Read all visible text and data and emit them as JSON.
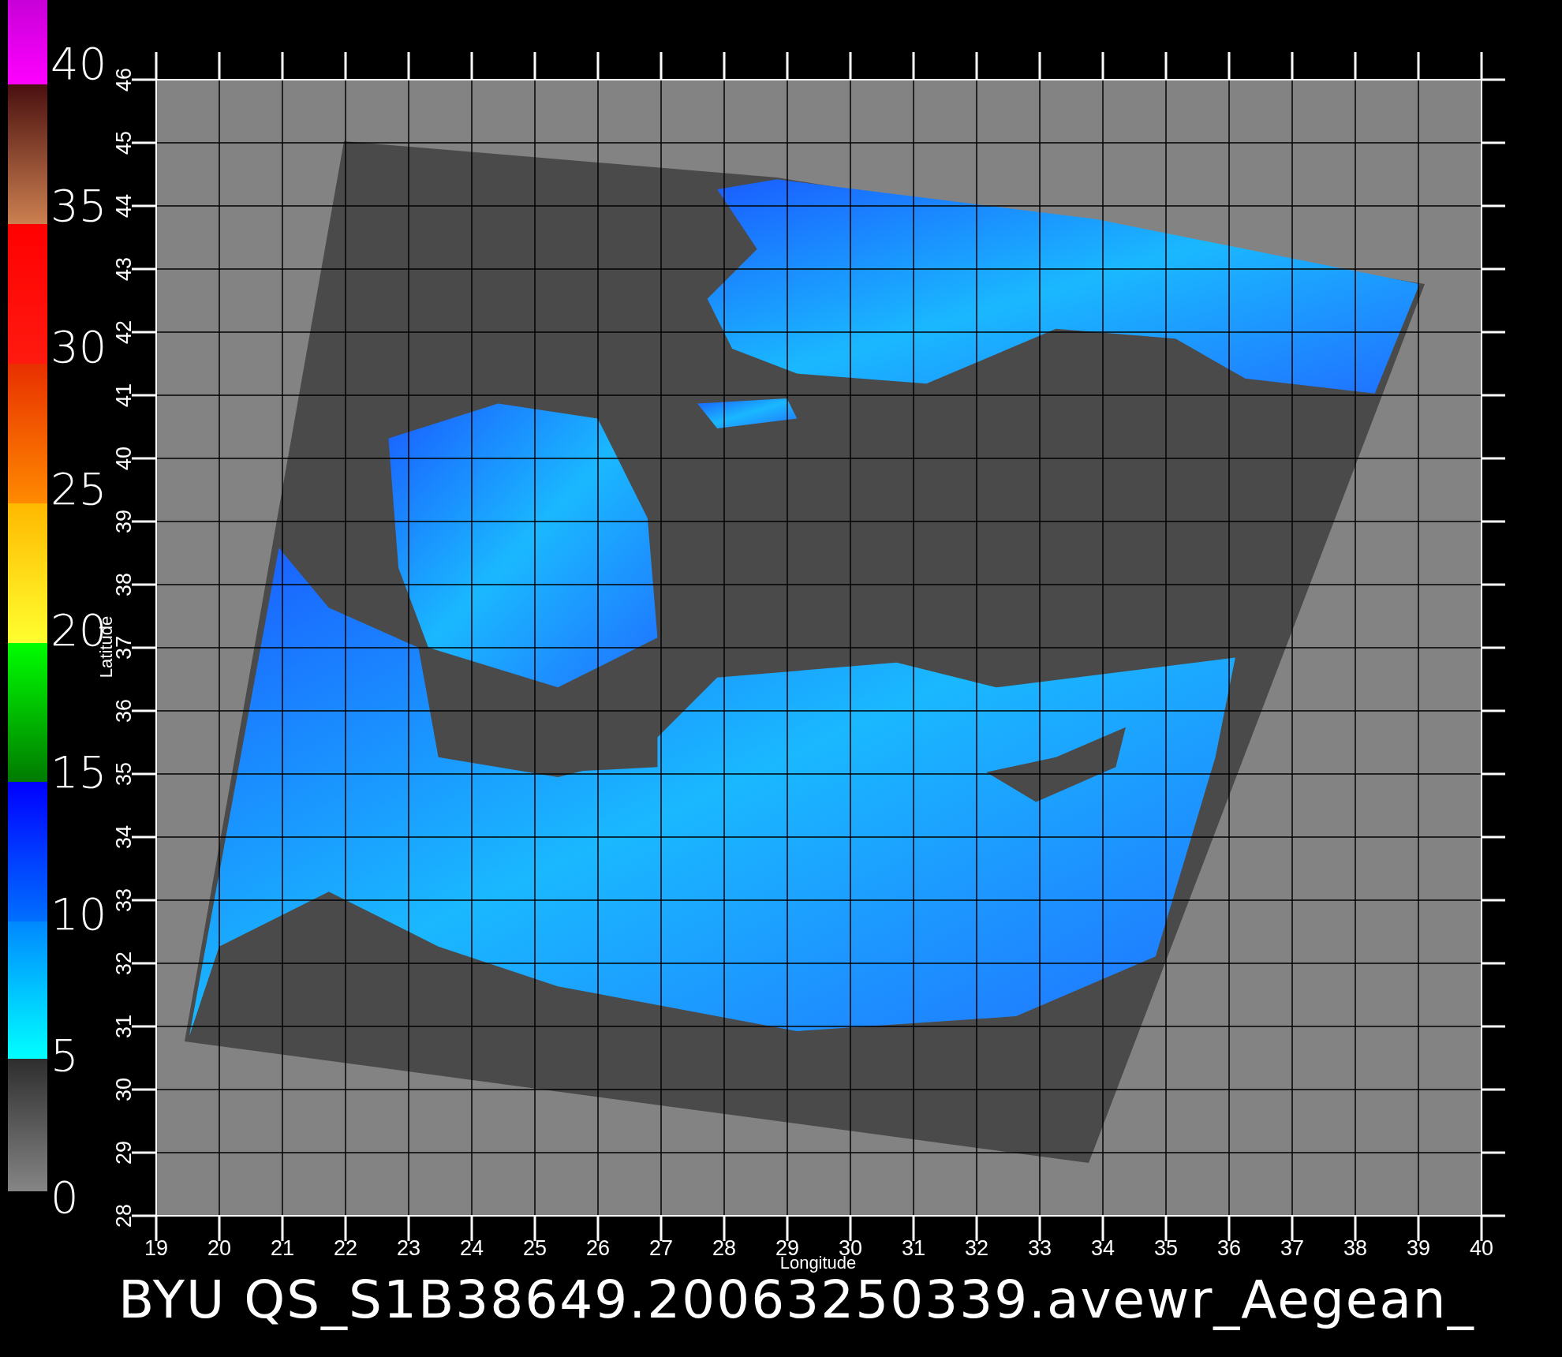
{
  "colorbar": {
    "labels": [
      "40",
      "35",
      "30",
      "25",
      "20",
      "15",
      "10",
      "5",
      "0"
    ]
  },
  "plot": {
    "y_axis": {
      "label": "Latitude",
      "ticks": [
        "28",
        "29",
        "30",
        "31",
        "32",
        "33",
        "34",
        "35",
        "36",
        "37",
        "38",
        "39",
        "40",
        "41",
        "42",
        "43",
        "44",
        "45",
        "46"
      ]
    },
    "x_axis": {
      "label": "Longitude",
      "ticks": [
        "19",
        "20",
        "21",
        "22",
        "23",
        "24",
        "25",
        "26",
        "27",
        "28",
        "29",
        "30",
        "31",
        "32",
        "33",
        "34",
        "35",
        "36",
        "37",
        "38",
        "39",
        "40"
      ]
    }
  },
  "title": "BYU QS_S1B38649.20063250339.avewr_Aegean_"
}
